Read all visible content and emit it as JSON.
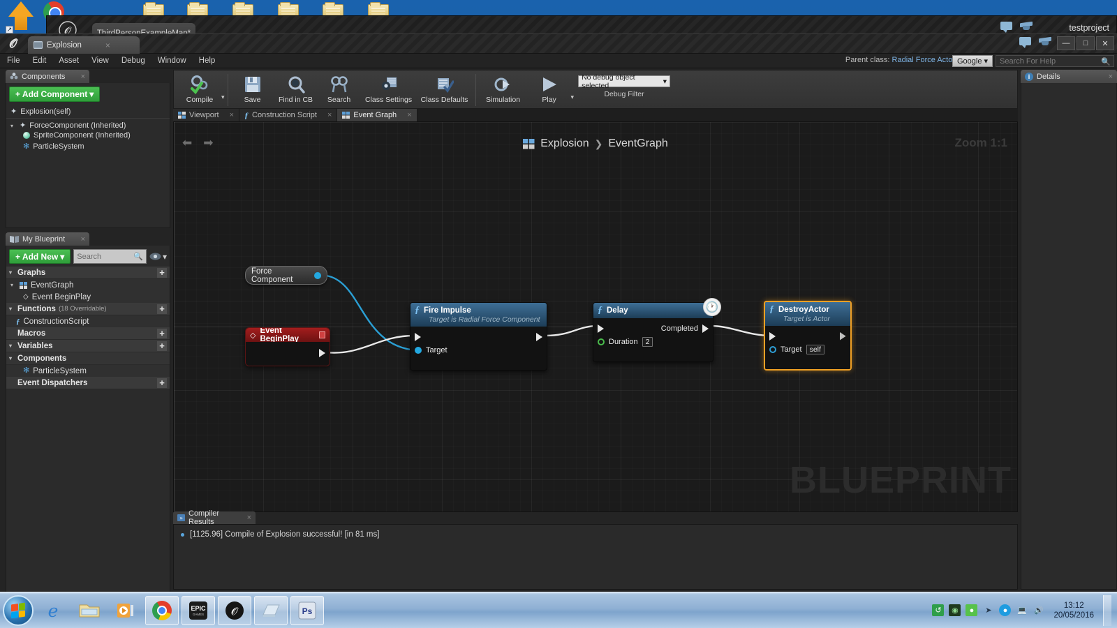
{
  "desktop": {
    "launcher_icon": "unreal-engine-launcher-icon",
    "chrome_icon": "google-chrome-icon",
    "folder_count": 6
  },
  "background_window": {
    "tab_label": "ThirdPersonExampleMap*",
    "project_name": "testproject"
  },
  "titlebar": {
    "asset_tab_label": "Explosion",
    "asset_tab_icon": "blueprint-icon",
    "close_glyph": "×",
    "minimize_label": "—",
    "maximize_label": "□",
    "close_label": "✕"
  },
  "menubar": {
    "items": [
      "File",
      "Edit",
      "Asset",
      "View",
      "Debug",
      "Window",
      "Help"
    ],
    "parent_class_label": "Parent class:",
    "parent_class_value": "Radial Force Actor",
    "search_provider": "Google",
    "help_search_placeholder": "Search For Help"
  },
  "components_panel": {
    "tab_label": "Components",
    "add_button_label": "+ Add Component",
    "root_label": "Explosion(self)",
    "tree": [
      {
        "label": "ForceComponent (Inherited)",
        "icon": "force-component-icon",
        "depth": 0
      },
      {
        "label": "SpriteComponent (Inherited)",
        "icon": "sprite-component-icon",
        "depth": 1
      },
      {
        "label": "ParticleSystem",
        "icon": "particle-system-icon",
        "depth": 1
      }
    ]
  },
  "my_blueprint_panel": {
    "tab_label": "My Blueprint",
    "add_new_label": "+ Add New",
    "search_placeholder": "Search",
    "sections": [
      {
        "title": "Graphs",
        "note": "",
        "plus": "+",
        "items": [
          {
            "label": "EventGraph",
            "icon": "event-graph-icon",
            "depth": 0
          },
          {
            "label": "Event BeginPlay",
            "icon": "event-node-icon",
            "depth": 1
          }
        ]
      },
      {
        "title": "Functions",
        "note": "(18 Overridable)",
        "plus": "+",
        "items": [
          {
            "label": "ConstructionScript",
            "icon": "function-icon",
            "depth": 0
          }
        ]
      },
      {
        "title": "Macros",
        "note": "",
        "plus": "+",
        "items": []
      },
      {
        "title": "Variables",
        "note": "",
        "plus": "+",
        "items": []
      },
      {
        "title": "Components",
        "note": "",
        "plus": "",
        "items": [
          {
            "label": "ParticleSystem",
            "icon": "particle-system-icon",
            "depth": 1
          }
        ]
      },
      {
        "title": "Event Dispatchers",
        "note": "",
        "plus": "+",
        "items": []
      }
    ]
  },
  "toolbar": {
    "items": [
      {
        "label": "Compile",
        "icon": "compile-icon",
        "has_dropdown": true
      },
      {
        "label": "Save",
        "icon": "save-icon",
        "has_dropdown": false
      },
      {
        "label": "Find in CB",
        "icon": "find-in-content-browser-icon",
        "has_dropdown": false
      },
      {
        "label": "Search",
        "icon": "search-icon",
        "has_dropdown": false
      },
      {
        "label": "Class Settings",
        "icon": "class-settings-icon",
        "has_dropdown": false
      },
      {
        "label": "Class Defaults",
        "icon": "class-defaults-icon",
        "has_dropdown": false
      },
      {
        "label": "Simulation",
        "icon": "simulation-icon",
        "has_dropdown": false
      },
      {
        "label": "Play",
        "icon": "play-icon",
        "has_dropdown": true
      }
    ],
    "debug_object_value": "No debug object selected",
    "debug_filter_label": "Debug Filter"
  },
  "graph_tabs": [
    {
      "label": "Viewport",
      "icon": "viewport-icon",
      "active": false
    },
    {
      "label": "Construction Script",
      "icon": "function-icon",
      "active": false
    },
    {
      "label": "Event Graph",
      "icon": "event-graph-icon",
      "active": true
    }
  ],
  "graph": {
    "breadcrumb_root": "Explosion",
    "breadcrumb_current": "EventGraph",
    "breadcrumb_separator": "❯",
    "zoom_label": "Zoom 1:1",
    "watermark": "BLUEPRINT",
    "back_arrow": "⬅",
    "forward_arrow": "➡",
    "nodes": {
      "force_component": {
        "title": "Force Component",
        "pin_icon": "object-pin-icon"
      },
      "event_begin_play": {
        "title": "Event BeginPlay",
        "icon": "event-diamond-icon"
      },
      "fire_impulse": {
        "title": "Fire Impulse",
        "subtitle": "Target is Radial Force Component",
        "icon": "function-f-icon",
        "input_pins": [
          {
            "label": "Target",
            "type": "object"
          }
        ],
        "exec_in": "",
        "exec_out": ""
      },
      "delay": {
        "title": "Delay",
        "icon": "function-f-icon",
        "badge_icon": "clock-icon",
        "out_label": "Completed",
        "duration_label": "Duration",
        "duration_value": "2"
      },
      "destroy_actor": {
        "title": "DestroyActor",
        "subtitle": "Target is Actor",
        "icon": "function-f-icon",
        "target_label": "Target",
        "target_value": "self",
        "selected": true
      }
    }
  },
  "compiler_results": {
    "tab_label": "Compiler Results",
    "tab_icon": "compiler-results-icon",
    "messages": [
      "[1125.96] Compile of Explosion successful! [in 81 ms]"
    ]
  },
  "details_panel": {
    "tab_label": "Details",
    "tab_icon": "details-info-icon"
  },
  "taskbar": {
    "start_label": "start-orb",
    "pinned": [
      {
        "name": "internet-explorer-icon"
      },
      {
        "name": "windows-explorer-icon"
      },
      {
        "name": "windows-media-player-icon"
      }
    ],
    "running": [
      {
        "name": "google-chrome-icon"
      },
      {
        "name": "epic-games-launcher-icon"
      },
      {
        "name": "unreal-engine-editor-icon"
      },
      {
        "name": "notepad-window-icon"
      },
      {
        "name": "photoshop-icon",
        "label": "Ps"
      }
    ],
    "tray": [
      {
        "name": "sync-icon"
      },
      {
        "name": "nvidia-icon"
      },
      {
        "name": "shield-icon"
      },
      {
        "name": "pointer-icon"
      },
      {
        "name": "messenger-icon"
      },
      {
        "name": "network-icon"
      },
      {
        "name": "volume-icon"
      }
    ],
    "time": "13:12",
    "date": "20/05/2016"
  },
  "colors": {
    "accent_blue": "#23a8e0",
    "selected_orange": "#f0a024",
    "event_red": "#a31d1d",
    "green_button": "#2f9e3a",
    "node_header_blue": "#3e6f96"
  }
}
